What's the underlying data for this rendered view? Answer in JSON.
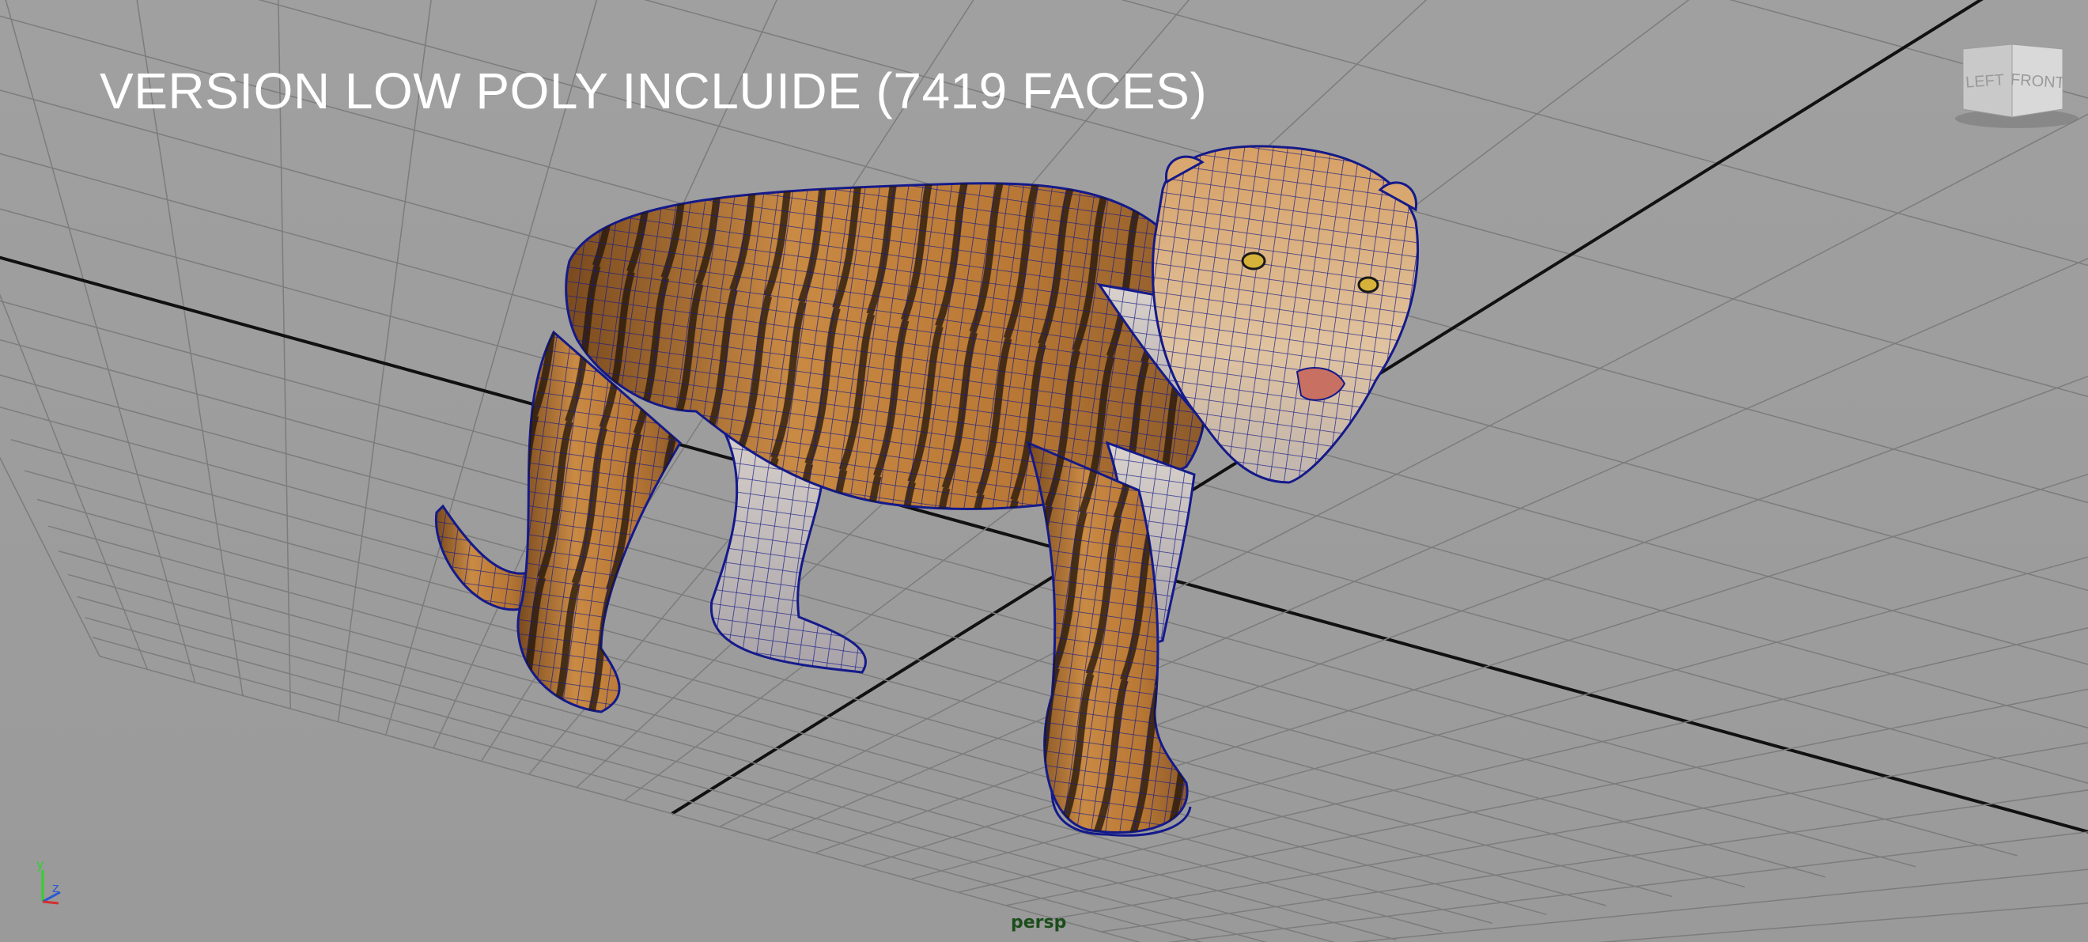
{
  "viewport": {
    "overlay_title": "VERSION LOW POLY INCLUIDE (7419 FACES)",
    "camera_label": "persp",
    "view_cube": {
      "left_face": "LEFT",
      "front_face": "FRONT"
    },
    "axis_labels": {
      "y": "y",
      "z": "z"
    },
    "colors": {
      "background": "#9b9b9b",
      "grid_line": "#7c7c7c",
      "grid_axis": "#111111",
      "wireframe": "#141a8a",
      "camera_label": "#1c4d1c"
    }
  }
}
